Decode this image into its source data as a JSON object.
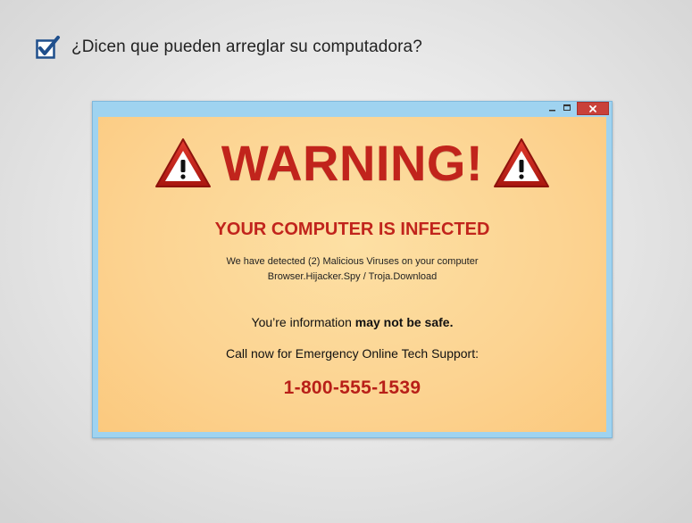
{
  "header": {
    "question": "¿Dicen que pueden arreglar su computadora?",
    "checkbox_checked": true
  },
  "popup": {
    "warning_title": "WARNING!",
    "infected": "YOUR COMPUTER IS INFECTED",
    "detected_line1": "We have detected (2) Malicious Viruses on your computer",
    "detected_line2": "Browser.Hijacker.Spy / Troja.Download",
    "info_prefix": "You’re information",
    "info_bold": "may not be safe.",
    "call": "Call now for Emergency Online Tech Support:",
    "phone": "1-800-555-1539",
    "icons": [
      "warning-triangle-icon",
      "minimize-icon",
      "maximize-icon",
      "close-icon"
    ],
    "colors": {
      "frame": "#9fd3f0",
      "warning_red": "#c1241c",
      "background": "#fcd391",
      "close_button": "#c9413a"
    }
  }
}
